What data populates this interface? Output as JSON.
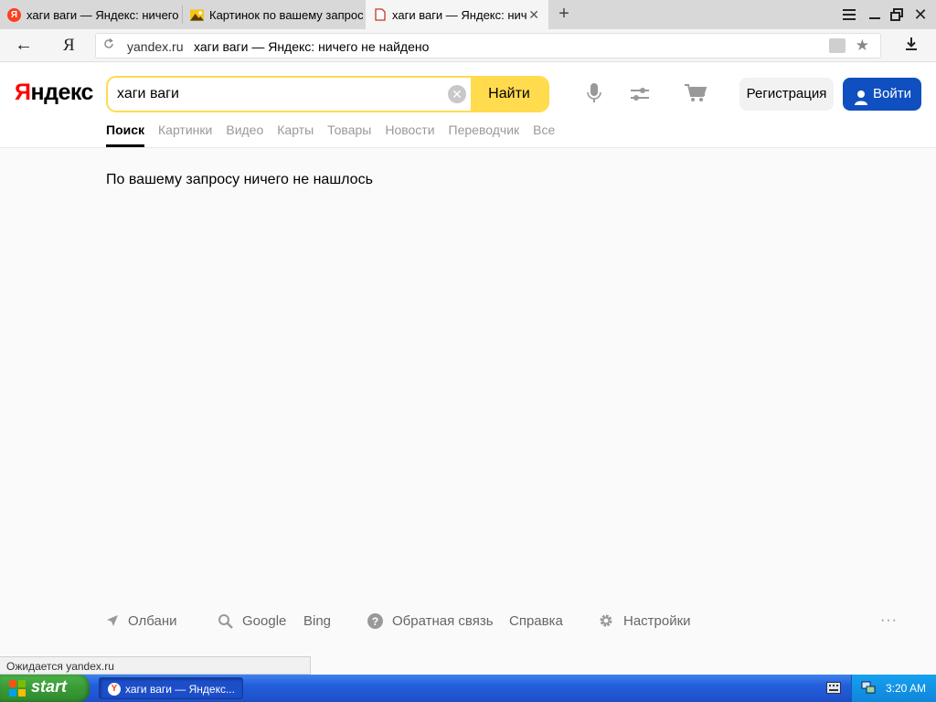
{
  "browser": {
    "tabs": [
      {
        "title": "хаги ваги — Яндекс: ничего",
        "favicon": "yandex-icon",
        "active": false
      },
      {
        "title": "Картинок по вашему запрос",
        "favicon": "image-icon",
        "active": false
      },
      {
        "title": "хаги ваги — Яндекс: нич",
        "favicon": "page-loading-icon",
        "active": true
      }
    ],
    "close_glyph": "✕",
    "new_tab_glyph": "+",
    "back_glyph": "←",
    "home_glyph": "Я",
    "address": {
      "domain": "yandex.ru",
      "page_title": "хаги ваги — Яндекс: ничего не найдено"
    },
    "star_glyph": "★",
    "download_glyph": "⭳"
  },
  "header": {
    "logo_first": "Я",
    "logo_rest": "ндекс",
    "search_value": "хаги ваги",
    "clear_glyph": "✕",
    "search_button": "Найти",
    "register_button": "Регистрация",
    "login_button": "Войти"
  },
  "nav": [
    {
      "label": "Поиск",
      "active": true
    },
    {
      "label": "Картинки"
    },
    {
      "label": "Видео"
    },
    {
      "label": "Карты"
    },
    {
      "label": "Товары"
    },
    {
      "label": "Новости"
    },
    {
      "label": "Переводчик"
    },
    {
      "label": "Все"
    }
  ],
  "main": {
    "no_results_text": "По вашему запросу ничего не нашлось"
  },
  "footer": {
    "region": "Олбани",
    "google": "Google",
    "bing": "Bing",
    "feedback": "Обратная связь",
    "help": "Справка",
    "settings": "Настройки",
    "more": "···"
  },
  "status": {
    "text": "Ожидается yandex.ru"
  },
  "taskbar": {
    "start_label": "start",
    "task_title": "хаги ваги — Яндекс...",
    "task_favicon_glyph": "Y",
    "clock": "3:20 AM"
  },
  "colors": {
    "accent_yellow": "#ffdb4d",
    "login_blue": "#0f4fc0",
    "logo_red": "#ff0000"
  }
}
